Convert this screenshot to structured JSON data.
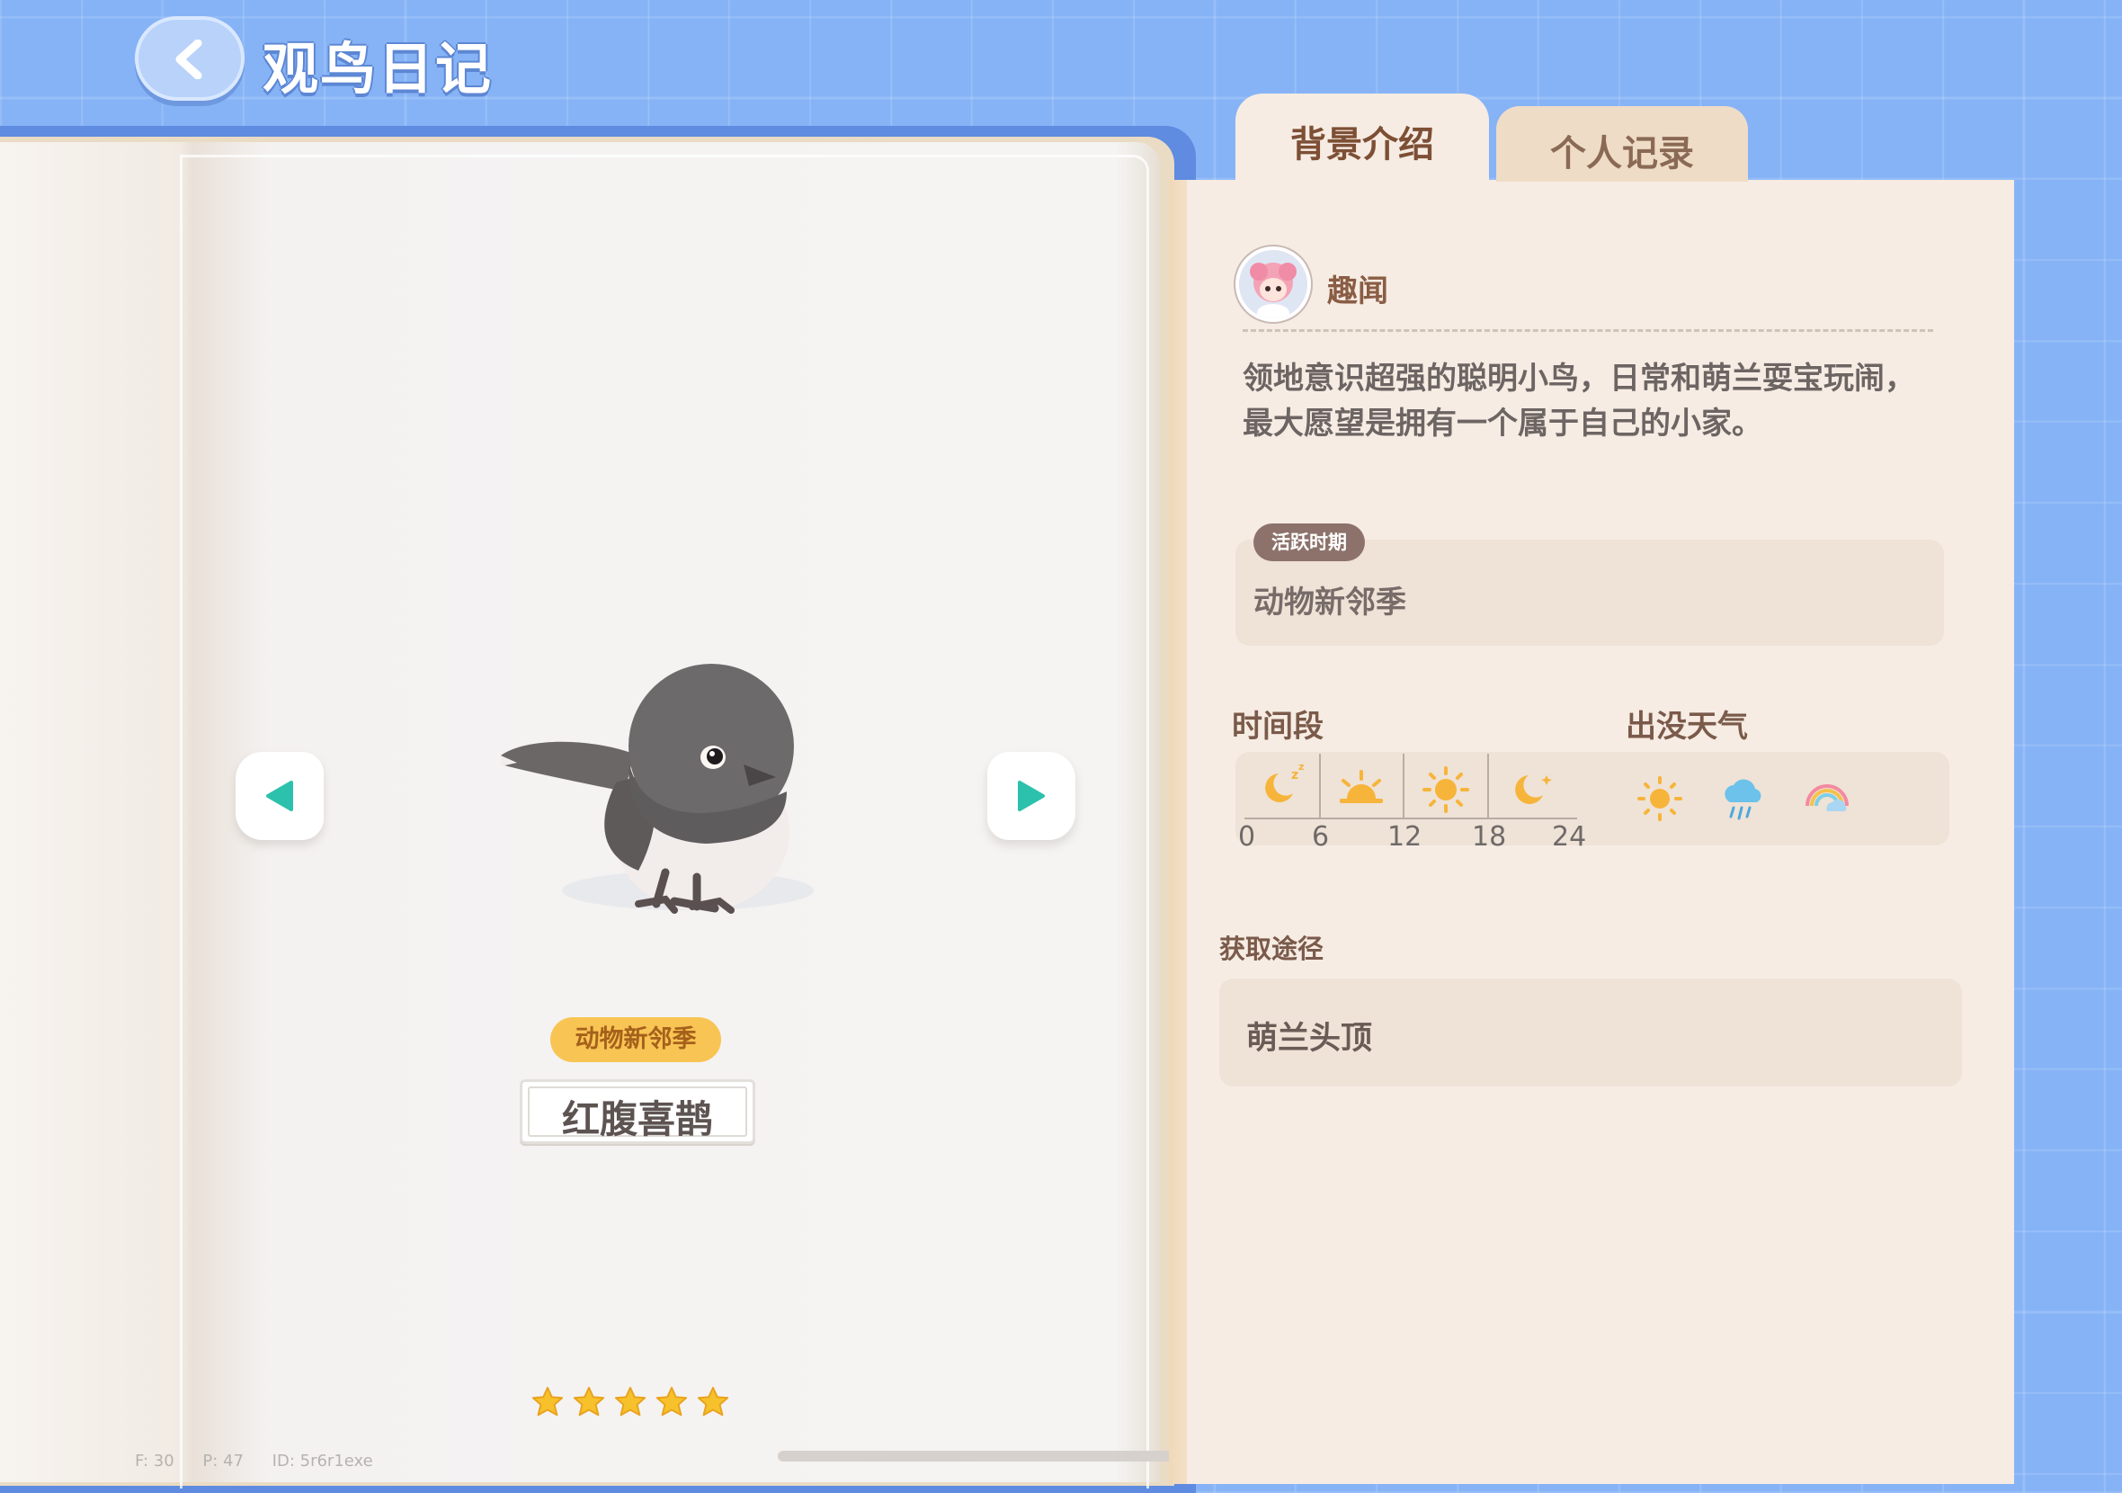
{
  "header": {
    "title": "观鸟日记",
    "back_icon": "chevron-left-icon"
  },
  "tabs": [
    {
      "label": "背景介绍",
      "active": true
    },
    {
      "label": "个人记录",
      "active": false
    }
  ],
  "bird": {
    "season_tag": "动物新邻季",
    "name": "红腹喜鹊",
    "rating": 5,
    "rating_max": 5,
    "prev_icon": "triangle-left-icon",
    "next_icon": "triangle-right-icon"
  },
  "trivia": {
    "label": "趣闻",
    "text": "领地意识超强的聪明小鸟，日常和萌兰耍宝玩闹，最大愿望是拥有一个属于自己的小家。"
  },
  "active_period": {
    "tag": "活跃时期",
    "value": "动物新邻季"
  },
  "time_section": {
    "label": "时间段",
    "ticks": [
      "0",
      "6",
      "12",
      "18",
      "24"
    ],
    "icons": [
      "moon-sleep-icon",
      "sunrise-icon",
      "sun-icon",
      "moon-icon"
    ]
  },
  "weather_section": {
    "label": "出没天气",
    "icons": [
      "sunny-icon",
      "rain-icon",
      "rainbow-icon"
    ]
  },
  "obtain": {
    "label": "获取途径",
    "value": "萌兰头顶"
  },
  "debug": {
    "fps": "F: 30",
    "ping": "P: 47",
    "id": "ID: 5r6r1exe"
  },
  "colors": {
    "background": "#86b3f6",
    "accent_teal": "#2cc1ad",
    "star": "#f6c12b",
    "panel": "#f6ece3"
  }
}
